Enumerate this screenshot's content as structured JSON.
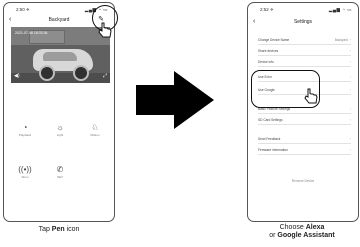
{
  "left_phone": {
    "status": {
      "time": "2:50 ✈",
      "icons": "▂▄▆ ◔ ▭"
    },
    "title": "Backyard",
    "back_icon": "chevron-left-icon",
    "edit_icon": "pen-icon",
    "camera_overlay_tl": "2021-07-06 18:32:34",
    "actions": [
      {
        "icon": "playback-icon",
        "label": "Playback"
      },
      {
        "icon": "light-icon",
        "label": "Light"
      },
      {
        "icon": "motion-icon",
        "label": "Motion"
      },
      {
        "icon": "siren-icon",
        "label": "Siren"
      },
      {
        "icon": "phone-icon",
        "label": "SET"
      }
    ]
  },
  "right_phone": {
    "status": {
      "time": "2:52 ✈",
      "icons": "▂▄▆ ◔ ▭"
    },
    "title": "Settings",
    "rows": [
      {
        "label": "Change Device Name",
        "value": "Backyard"
      },
      {
        "label": "Share devices",
        "value": ""
      },
      {
        "label": "Device info",
        "value": ""
      },
      {
        "label": "Use Echo",
        "value": ""
      },
      {
        "label": "Use Google",
        "value": ""
      },
      {
        "label": "Basic Feature Settings",
        "value": ""
      },
      {
        "label": "SD Card Settings",
        "value": ""
      },
      {
        "label": "Send Feedback",
        "value": ""
      },
      {
        "label": "Firmware information",
        "value": ""
      }
    ],
    "remove_label": "Remove Device"
  },
  "captions": {
    "left_prefix": "Tap ",
    "left_bold": "Pen",
    "left_suffix": " icon",
    "right_line1_prefix": "Choose ",
    "right_line1_bold": "Alexa",
    "right_line2_prefix": "or ",
    "right_line2_bold": "Google Assistant"
  },
  "colors": {
    "arrow": "#000000",
    "outline": "#111111"
  }
}
